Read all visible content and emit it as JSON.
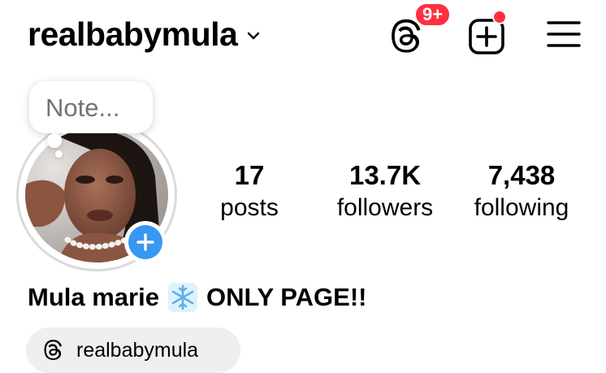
{
  "header": {
    "username": "realbabymula",
    "threads_badge": "9+",
    "icons": {
      "chevron": "chevron-down-icon",
      "threads": "threads-icon",
      "new_post": "add-post-icon",
      "menu": "hamburger-menu-icon"
    }
  },
  "profile": {
    "note_placeholder": "Note...",
    "stats": [
      {
        "value": "17",
        "label": "posts"
      },
      {
        "value": "13.7K",
        "label": "followers"
      },
      {
        "value": "7,438",
        "label": "following"
      }
    ],
    "bio_name_left": "Mula marie",
    "bio_name_right": "ONLY PAGE!!",
    "threads_link": "realbabymula"
  },
  "colors": {
    "badge": "#ff3040",
    "add_story": "#3897f0",
    "chip_bg": "#efefef",
    "ring": "#dbdbdb",
    "muted_text": "#737373"
  }
}
